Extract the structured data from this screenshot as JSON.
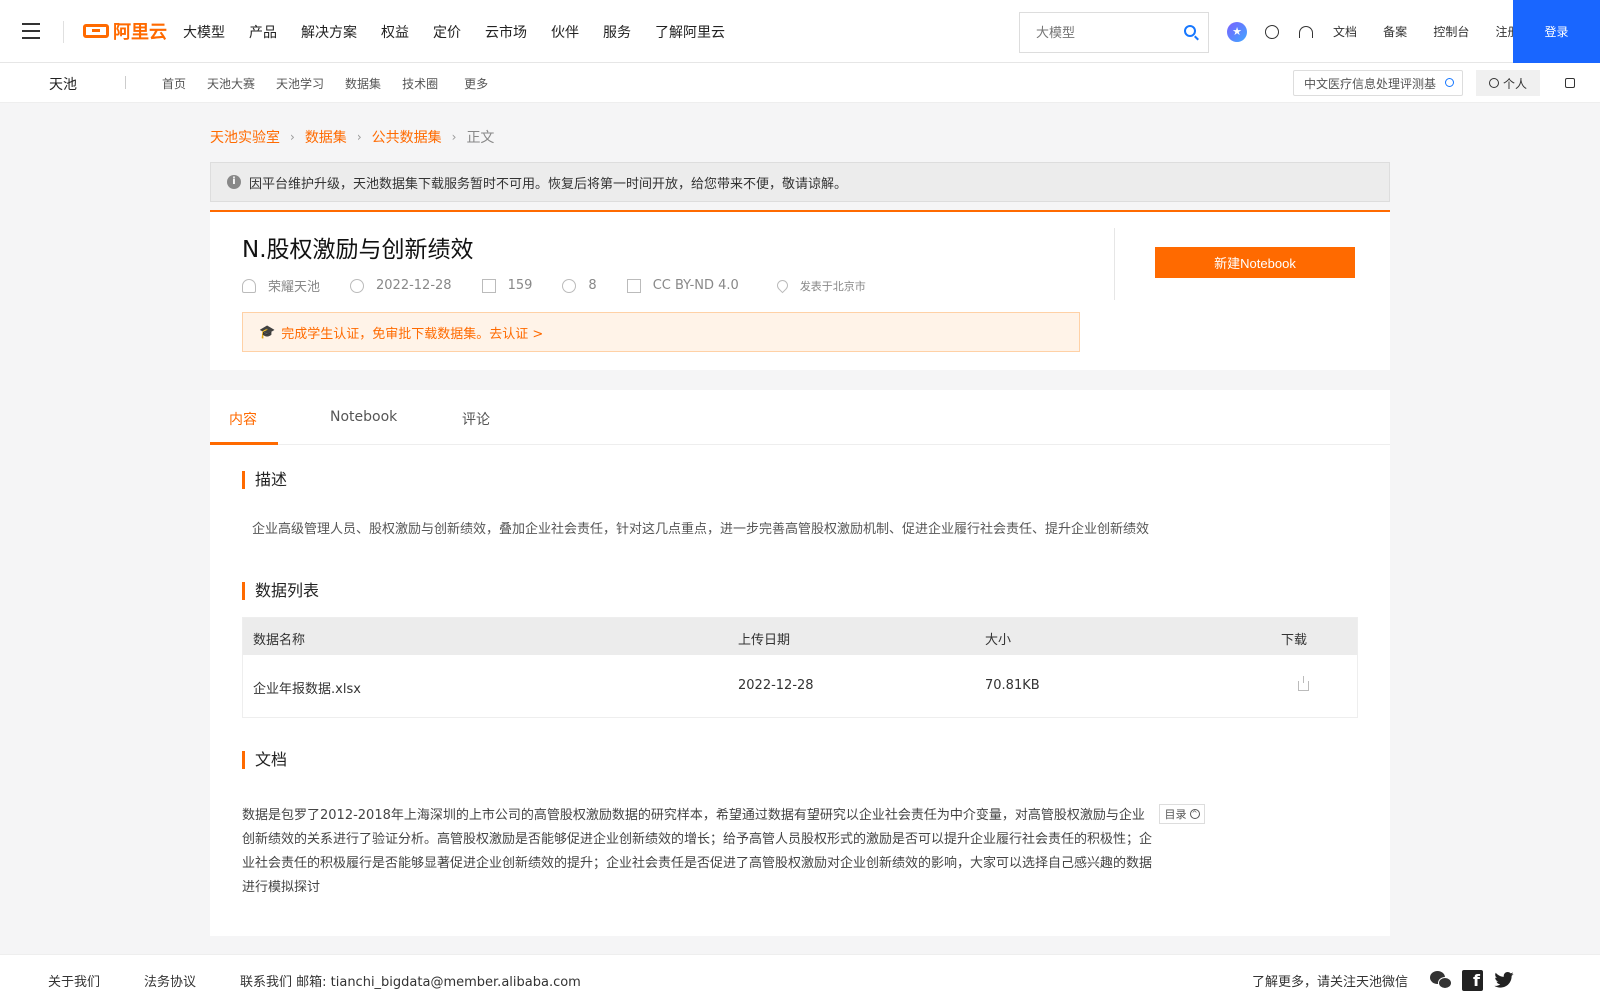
{
  "topnav": {
    "logo_text": "阿里云",
    "menu": [
      "大模型",
      "产品",
      "解决方案",
      "权益",
      "定价",
      "云市场",
      "伙伴",
      "服务",
      "了解阿里云"
    ],
    "search_placeholder": "大模型",
    "links": [
      "文档",
      "备案",
      "控制台",
      "注册"
    ],
    "login_label": "登录"
  },
  "subnav": {
    "brand": "天池",
    "links": [
      "首页",
      "天池大赛",
      "天池学习",
      "数据集",
      "技术圈",
      "更多"
    ],
    "search_value": "中文医疗信息处理评测基",
    "personal_label": "个人"
  },
  "breadcrumb": [
    "天池实验室",
    "数据集",
    "公共数据集",
    "正文"
  ],
  "notice": "因平台维护升级，天池数据集下载服务暂时不可用。恢复后将第一时间开放，给您带来不便，敬请谅解。",
  "dataset": {
    "title": "N.股权激励与创新绩效",
    "author": "荣耀天池",
    "date": "2022-12-28",
    "downloads": "159",
    "likes": "8",
    "license": "CC BY-ND 4.0",
    "location": "发表于北京市",
    "student_prompt": "完成学生认证，免审批下载数据集。去认证 >",
    "new_notebook_label": "新建Notebook"
  },
  "tabs": [
    "内容",
    "Notebook",
    "评论"
  ],
  "sections": {
    "description_title": "描述",
    "description": "企业高级管理人员、股权激励与创新绩效，叠加企业社会责任，针对这几点重点，进一步完善高管股权激励机制、促进企业履行社会责任、提升企业创新绩效",
    "datalist_title": "数据列表",
    "docs_title": "文档"
  },
  "table": {
    "headers": [
      "数据名称",
      "上传日期",
      "大小",
      "下载"
    ],
    "rows": [
      {
        "name": "企业年报数据.xlsx",
        "date": "2022-12-28",
        "size": "70.81KB"
      }
    ]
  },
  "docs": {
    "text": "数据是包罗了2012-2018年上海深圳的上市公司的高管股权激励数据的研究样本，希望通过数据有望研究以企业社会责任为中介变量，对高管股权激励与企业创新绩效的关系进行了验证分析。高管股权激励是否能够促进企业创新绩效的增长；给予高管人员股权形式的激励是否可以提升企业履行社会责任的积极性；企业社会责任的积极履行是否能够显著促进企业创新绩效的提升；企业社会责任是否促进了高管股权激励对企业创新绩效的影响，大家可以选择自己感兴趣的数据进行模拟探讨",
    "toc_label": "目录"
  },
  "footer": {
    "about": "关于我们",
    "legal": "法务协议",
    "contact": "联系我们 邮箱: tianchi_bigdata@member.alibaba.com",
    "follow": "了解更多，请关注天池微信"
  },
  "colors": {
    "accent": "#ff6a00",
    "login_blue": "#1966ff"
  }
}
